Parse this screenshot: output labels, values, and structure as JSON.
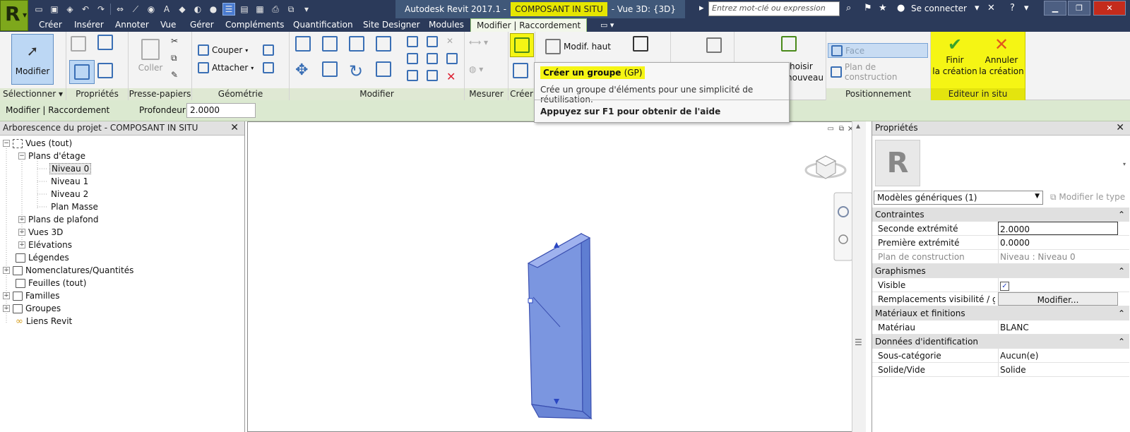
{
  "titlebar": {
    "app": "Autodesk Revit 2017.1 -",
    "doc": "COMPOSANT IN SITU",
    "view": "- Vue 3D: {3D}",
    "search_placeholder": "Entrez mot-clé ou expression",
    "signin": "Se connecter"
  },
  "menu": [
    "Créer",
    "Insérer",
    "Annoter",
    "Vue",
    "Gérer",
    "Compléments",
    "Quantification",
    "Site Designer",
    "Modules",
    "Modifier | Raccordement"
  ],
  "ribbon": {
    "modifier_label": "Modifier",
    "coller_label": "Coller",
    "couper_label": "Couper",
    "attacher_label": "Attacher",
    "modif_haut_label": "Modif. haut",
    "choisir_label": "hoisir",
    "nouveau_label": "nouveau",
    "face_label": "Face",
    "plan_construction_label": "Plan de construction",
    "finir_label_1": "Finir",
    "finir_label_2": "la création",
    "annuler_label_1": "Annuler",
    "annuler_label_2": "la création",
    "panels": {
      "selectionner": "Sélectionner",
      "proprietes": "Propriétés",
      "presse_papiers": "Presse-papiers",
      "geometrie": "Géométrie",
      "modifier": "Modifier",
      "mesurer": "Mesurer",
      "creer": "Créer",
      "positionnement": "Positionnement",
      "editeur_in_situ": "Editeur in situ"
    }
  },
  "tooltip": {
    "title": "Créer un groupe",
    "shortcut": "(GP)",
    "description": "Crée un groupe d'éléments pour une simplicité de réutilisation.",
    "help": "Appuyez sur F1 pour obtenir de l'aide"
  },
  "options_bar": {
    "context": "Modifier | Raccordement",
    "profondeur_label": "Profondeur",
    "profondeur_value": "2.0000"
  },
  "browser": {
    "title": "Arborescence du projet - COMPOSANT IN SITU",
    "items": [
      "Vues (tout)",
      "Plans d'étage",
      "Niveau 0",
      "Niveau 1",
      "Niveau 2",
      "Plan Masse",
      "Plans de plafond",
      "Vues 3D",
      "Elévations",
      "Légendes",
      "Nomenclatures/Quantités",
      "Feuilles (tout)",
      "Familles",
      "Groupes",
      "Liens Revit"
    ]
  },
  "properties": {
    "title": "Propriétés",
    "type_select": "Modèles génériques (1)",
    "edit_type": "Modifier le type",
    "categories": {
      "contraintes": "Contraintes",
      "graphismes": "Graphismes",
      "materiaux": "Matériaux et finitions",
      "identification": "Données d'identification"
    },
    "rows": {
      "seconde_label": "Seconde extrémité",
      "seconde_value": "2.0000",
      "premiere_label": "Première extrémité",
      "premiere_value": "0.0000",
      "plan_label": "Plan de construction",
      "plan_value": "Niveau : Niveau 0",
      "visible_label": "Visible",
      "remplacements_label": "Remplacements visibilité / g...",
      "remplacements_button": "Modifier...",
      "materiau_label": "Matériau",
      "materiau_value": "BLANC",
      "souscat_label": "Sous-catégorie",
      "souscat_value": "Aucun(e)",
      "solide_label": "Solide/Vide",
      "solide_value": "Solide"
    }
  },
  "colors": {
    "titlebar": "#2b3a5a",
    "highlight_yellow": "#f5f514",
    "ribbon_panel_label": "#dfe8d3",
    "model_blue": "#7b96e0"
  }
}
